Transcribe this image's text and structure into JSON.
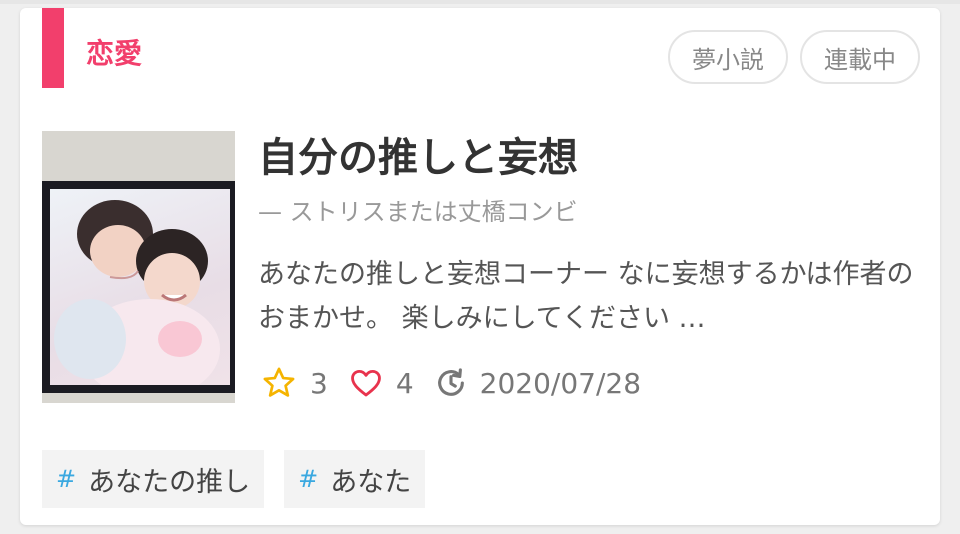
{
  "card": {
    "genre": "恋愛",
    "badges": [
      "夢小説",
      "連載中"
    ],
    "title": "自分の推しと妄想",
    "subtitle": "— ストリスまたは丈橋コンビ",
    "description": "あなたの推しと妄想コーナー なに妄想するかは作者のおまかせ。 楽しみにしてください …",
    "stats": {
      "stars": "3",
      "likes": "4",
      "updated": "2020/07/28"
    },
    "tags": [
      {
        "hash": "#",
        "label": "あなたの推し"
      },
      {
        "hash": "#",
        "label": "あなた"
      }
    ]
  },
  "colors": {
    "accent": "#f23f6c",
    "star": "#f5b400",
    "heart": "#e8334d",
    "hash": "#3aa8e0"
  },
  "icons": {
    "star": "star-outline-icon",
    "heart": "heart-outline-icon",
    "updated": "history-icon",
    "cover": "cover-image"
  }
}
